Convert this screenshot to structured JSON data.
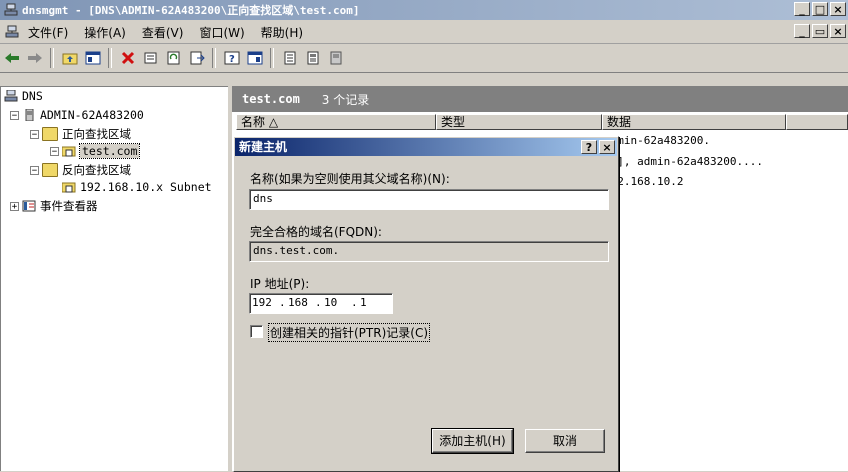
{
  "window": {
    "title": "dnsmgmt - [DNS\\ADMIN-62A483200\\正向查找区域\\test.com]",
    "minimize": "_",
    "maximize": "□",
    "close": "×"
  },
  "menu": {
    "items": [
      "文件(F)",
      "操作(A)",
      "查看(V)",
      "窗口(W)",
      "帮助(H)"
    ],
    "mdi_minimize": "_",
    "mdi_restore": "▭",
    "mdi_close": "×"
  },
  "toolbar": {
    "icons": [
      "back-icon",
      "forward-icon",
      "up-folder-icon",
      "show-hide-tree-icon",
      "delete-icon",
      "properties-icon",
      "refresh-icon",
      "export-icon",
      "help-icon",
      "console-icon",
      "list-view-icon",
      "detail-view-icon",
      "server-icon"
    ]
  },
  "tree": {
    "root": "DNS",
    "server": "ADMIN-62A483200",
    "forward_zones": "正向查找区域",
    "zone": "test.com",
    "reverse_zones": "反向查找区域",
    "reverse_zone": "192.168.10.x Subnet",
    "event_viewer": "事件查看器",
    "expand_minus": "−",
    "expand_plus": "+"
  },
  "list": {
    "zone_name": "test.com",
    "record_count": "3 个记录",
    "columns": [
      "名称 △",
      "类型",
      "数据"
    ],
    "rows": [
      {
        "data": "admin-62a483200."
      },
      {
        "data": "[1], admin-62a483200...."
      },
      {
        "data": "192.168.10.2"
      }
    ]
  },
  "dialog": {
    "title": "新建主机",
    "help": "?",
    "close": "×",
    "name_label": "名称(如果为空则使用其父域名称)(N):",
    "name_value": "dns",
    "fqdn_label": "完全合格的域名(FQDN):",
    "fqdn_value": "dns.test.com.",
    "ip_label": "IP 地址(P):",
    "ip": [
      "192",
      "168",
      "10",
      "1"
    ],
    "ptr_label": "创建相关的指针(PTR)记录(C)",
    "ptr_checked": false,
    "add_button": "添加主机(H)",
    "cancel_button": "取消"
  }
}
